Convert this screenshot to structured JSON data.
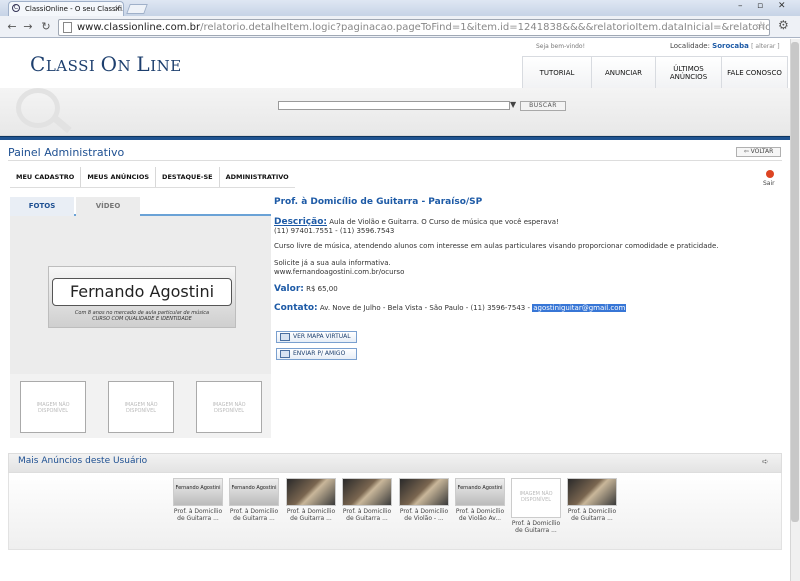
{
  "browser": {
    "tab_title": "ClassiOnline - O seu Classifi...",
    "url_host": "www.classionline.com.br",
    "url_path": "/relatorio.detalheItem.logic?paginacao.pageToFind=1&item.id=1241838&&&&relatorioItem.dataInicial=&relatorioItem.dataFinal=&"
  },
  "site": {
    "logo_big1": "C",
    "logo_small1": "LASSI ",
    "logo_big2": "O",
    "logo_small2": "N ",
    "logo_big3": "L",
    "logo_small3": "INE",
    "welcome": "Seja bem-vindo!",
    "localidade_label": "Localidade:",
    "localidade_city": "Sorocaba",
    "localidade_alter": "[ alterar ]",
    "nav": [
      "TUTORIAL",
      "ANUNCIAR",
      "ÚLTIMOS ANÚNCIOS",
      "FALE CONOSCO"
    ],
    "search_button": "BUSCAR"
  },
  "panel": {
    "title": "Painel Administrativo",
    "voltar": "VOLTAR",
    "subnav": [
      "MEU CADASTRO",
      "MEUS ANÚNCIOS",
      "DESTAQUE-SE",
      "ADMINISTRATIVO"
    ],
    "sair": "Sair"
  },
  "media": {
    "tab_fotos": "FOTOS",
    "tab_video": "VÍDEO",
    "image_name": "Fernando Agostini",
    "image_sub1": "Com 8 anos no mercado de aula particular de música",
    "image_sub2": "CURSO COM QUALIDADE E IDENTIDADE",
    "placeholder": "IMAGEM NÃO DISPONÍVEL"
  },
  "ad": {
    "title": "Prof. à Domicílio de Guitarra - Paraíso/SP",
    "desc_label": "Descrição:",
    "desc_text": " Aula de Violão e Guitarra. O Curso de música que você esperava!",
    "desc_phones": "(11) 97401.7551 - (11) 3596.7543",
    "para2": "Curso livre de música, atendendo alunos com interesse em aulas particulares visando proporcionar comodidade e praticidade.",
    "para3_line1": "Solicite já a sua aula informativa.",
    "para3_line2": "www.fernandoagostini.com.br/ocurso",
    "valor_label": "Valor:",
    "valor": " R$ 65,00",
    "contato_label": "Contato:",
    "contato_text": " Av. Nove de Julho - Bela Vista - São Paulo - (11) 3596-7543 - ",
    "email": "agostiniguitar@gmail.com",
    "btn_mapa": "VER MAPA VIRTUAL",
    "btn_amigo": "ENVIAR P/ AMIGO"
  },
  "mais": {
    "title": "Mais Anúncios deste Usuário",
    "items": [
      {
        "img": "fa",
        "mini": "Fernando Agostini",
        "caption": "Prof. à Domicílio de Guitarra ..."
      },
      {
        "img": "fa",
        "mini": "Fernando Agostini",
        "caption": "Prof. à Domicílio de Guitarra ..."
      },
      {
        "img": "gt",
        "mini": "",
        "caption": "Prof. à Domicílio de Guitarra ..."
      },
      {
        "img": "gt",
        "mini": "",
        "caption": "Prof. à Domicílio de Guitarra ..."
      },
      {
        "img": "gt",
        "mini": "",
        "caption": "Prof. à Domicílio de Violão - ..."
      },
      {
        "img": "fa",
        "mini": "Fernando Agostini",
        "caption": "Prof. à Domicílio de Violão Av..."
      },
      {
        "img": "na",
        "mini": "IMAGEM NÃO DISPONÍVEL",
        "caption": "Prof. à Domicílio de Guitarra ..."
      },
      {
        "img": "gt",
        "mini": "",
        "caption": "Prof. à Domicílio de Guitarra ..."
      }
    ]
  },
  "colors": {
    "accent": "#1d5aa6",
    "bar": "#1f5390"
  }
}
